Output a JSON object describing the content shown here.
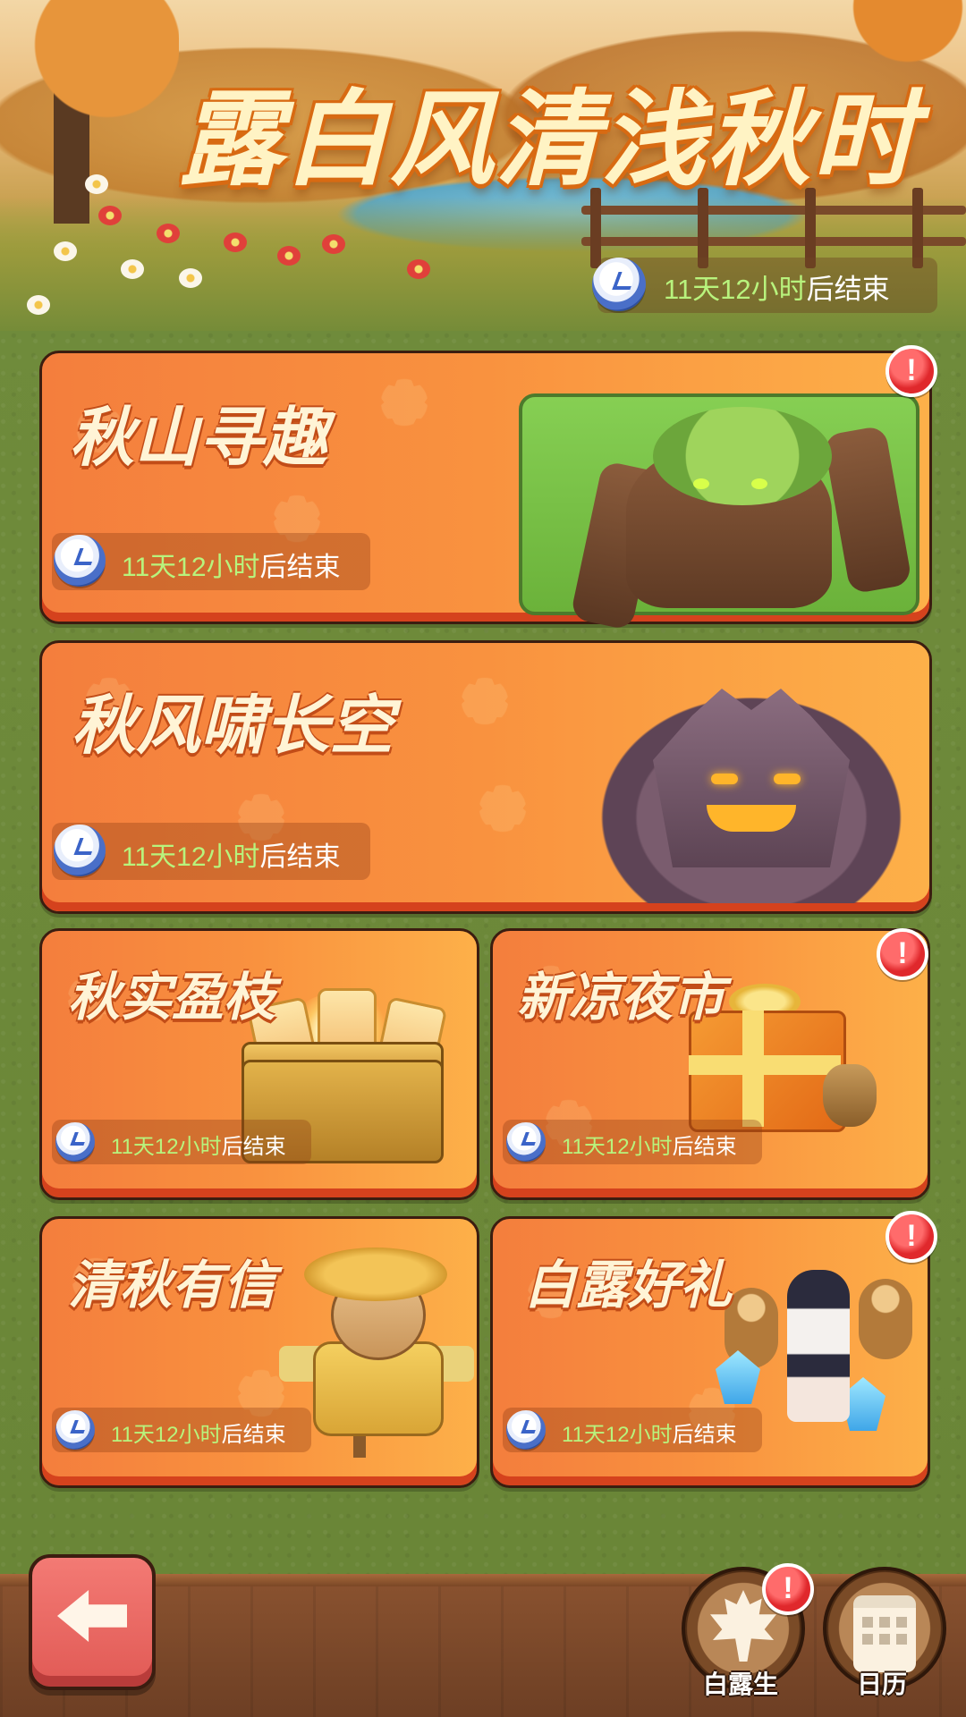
{
  "banner": {
    "title": "露白风清浅秋时",
    "timer_days": "11天12小时",
    "timer_suffix": "后结束"
  },
  "cards": [
    {
      "title": "秋山寻趣",
      "timer_days": "11天12小时",
      "timer_suffix": "后结束",
      "alert": "!"
    },
    {
      "title": "秋风啸长空",
      "timer_days": "11天12小时",
      "timer_suffix": "后结束"
    },
    {
      "title": "秋实盈枝",
      "timer_days": "11天12小时",
      "timer_suffix": "后结束"
    },
    {
      "title": "新凉夜市",
      "timer_days": "11天12小时",
      "timer_suffix": "后结束",
      "alert": "!"
    },
    {
      "title": "清秋有信",
      "timer_days": "11天12小时",
      "timer_suffix": "后结束"
    },
    {
      "title": "白露好礼",
      "timer_days": "11天12小时",
      "timer_suffix": "后结束",
      "alert": "!"
    }
  ],
  "bottom_bar": {
    "bailu_label": "白露生",
    "bailu_alert": "!",
    "calendar_label": "日历"
  },
  "colors": {
    "card_orange": "#f9923f",
    "timer_green": "#b8f37d",
    "alert_red": "#e0282c",
    "back_button": "#e15a55"
  },
  "icons": [
    "clock-icon",
    "back-arrow-icon",
    "maple-leaf-icon",
    "calendar-icon",
    "alert-icon"
  ]
}
